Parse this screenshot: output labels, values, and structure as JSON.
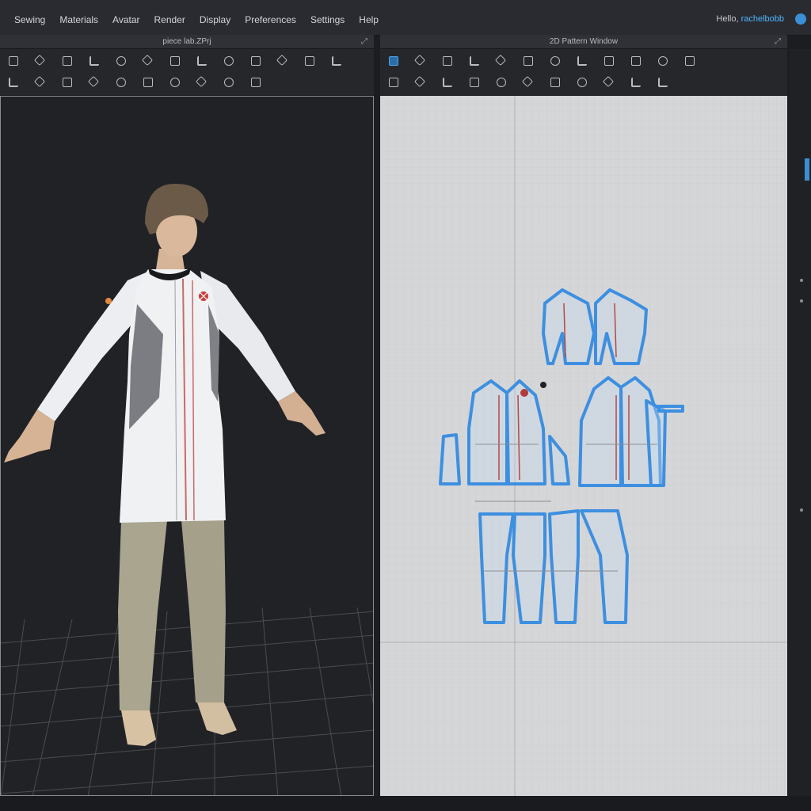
{
  "menu": [
    "Sewing",
    "Materials",
    "Avatar",
    "Render",
    "Display",
    "Preferences",
    "Settings",
    "Help"
  ],
  "user": {
    "greeting": "Hello,",
    "name": "rachelbobb"
  },
  "panels": {
    "left_title": "piece lab.ZPrj",
    "right_title": "2D Pattern Window"
  },
  "icons": {
    "expand": "expand-icon",
    "avatar": "avatar-icon"
  },
  "colors": {
    "accent": "#3a8fd6",
    "pattern_outline": "#3d8fe0",
    "garment_white": "#f1f2f4",
    "panel_dark": "#212226",
    "pattern_bg": "#d5d6d8",
    "logo_red": "#d23a3a"
  }
}
